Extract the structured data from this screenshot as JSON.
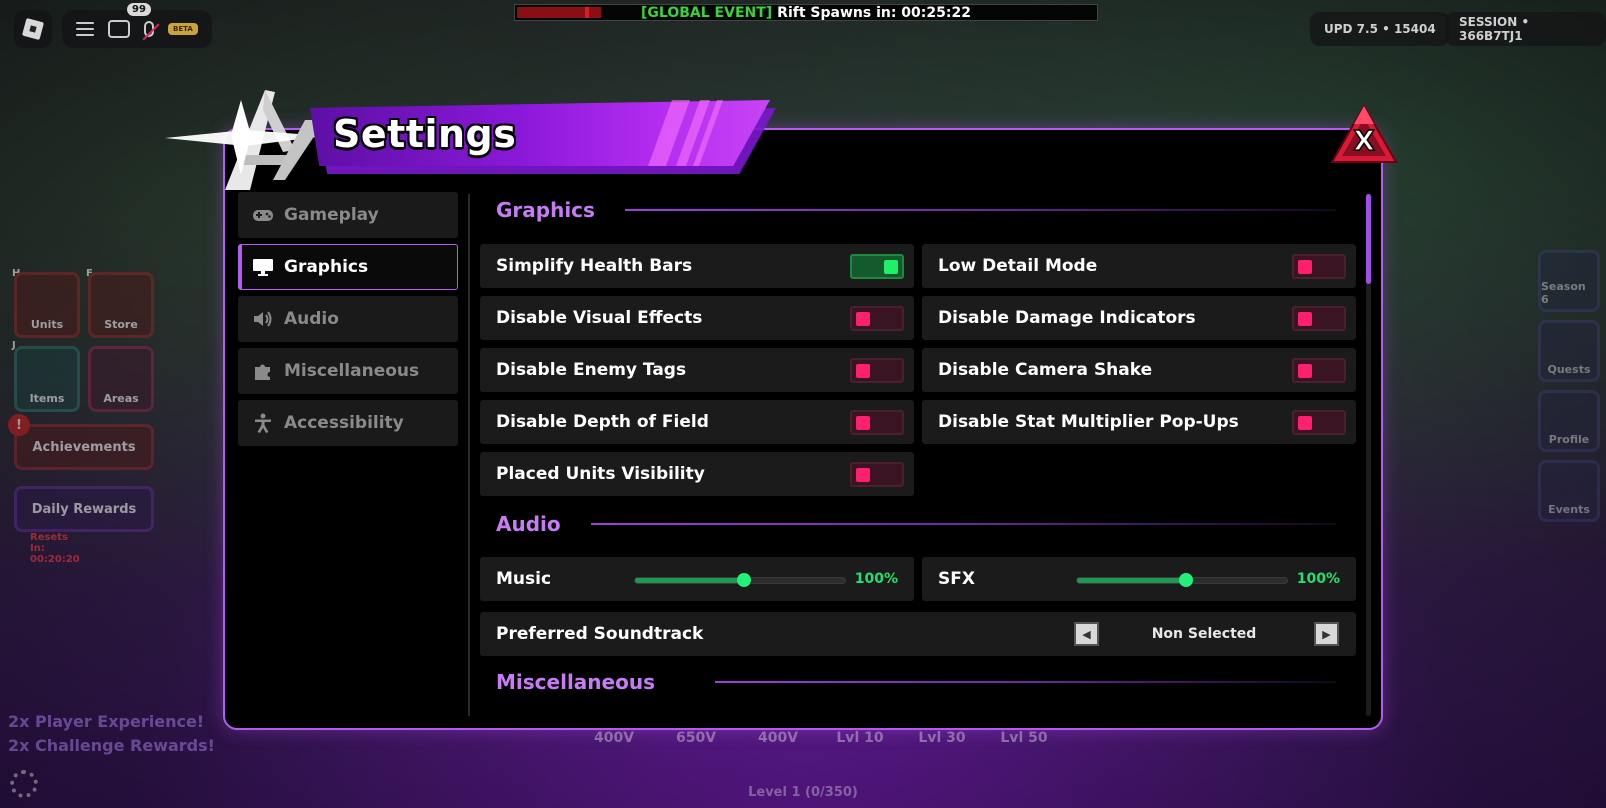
{
  "topbar": {
    "chat_badge": "99",
    "beta_label": "BETA",
    "event_tag": "[GLOBAL EVENT]",
    "event_text": "Rift Spawns in: 00:25:22",
    "version": "UPD 7.5 • 15404",
    "session": "SESSION • 366B7TJ1"
  },
  "hud_left": {
    "units": {
      "key": "H",
      "label": "Units"
    },
    "store": {
      "key": "F",
      "label": "Store"
    },
    "items": {
      "key": "J",
      "label": "Items"
    },
    "areas": {
      "label": "Areas"
    },
    "achievements": "Achievements",
    "alert": "!",
    "daily_rewards": "Daily Rewards",
    "daily_reset": "Resets In: 00:20:20"
  },
  "hud_right": {
    "season": "Season 6",
    "quests": "Quests",
    "profile": "Profile",
    "events": "Events"
  },
  "hud_bottom": {
    "slots": [
      "400V",
      "650V",
      "400V",
      "Lvl 10",
      "Lvl 30",
      "Lvl 50"
    ],
    "level": "Level 1 (0/350)",
    "bonus1": "2x Player Experience!",
    "bonus2": "2x Challenge Rewards!"
  },
  "settings": {
    "title": "Settings",
    "close_label": "X",
    "tabs": [
      {
        "label": "Gameplay",
        "icon": "gamepad-icon",
        "active": false
      },
      {
        "label": "Graphics",
        "icon": "monitor-icon",
        "active": true
      },
      {
        "label": "Audio",
        "icon": "speaker-icon",
        "active": false
      },
      {
        "label": "Miscellaneous",
        "icon": "puzzle-icon",
        "active": false
      },
      {
        "label": "Accessibility",
        "icon": "person-icon",
        "active": false
      }
    ],
    "sections": {
      "graphics": "Graphics",
      "audio": "Audio",
      "misc": "Miscellaneous"
    },
    "graphics_left": [
      {
        "label": "Simplify Health Bars",
        "on": true
      },
      {
        "label": "Disable Visual Effects",
        "on": false
      },
      {
        "label": "Disable Enemy Tags",
        "on": false
      },
      {
        "label": "Disable Depth of Field",
        "on": false
      },
      {
        "label": "Placed Units Visibility",
        "on": false
      }
    ],
    "graphics_right": [
      {
        "label": "Low Detail Mode",
        "on": false
      },
      {
        "label": "Disable Damage Indicators",
        "on": false
      },
      {
        "label": "Disable Camera Shake",
        "on": false
      },
      {
        "label": "Disable Stat Multiplier Pop-Ups",
        "on": false
      }
    ],
    "audio": {
      "music": {
        "label": "Music",
        "value": "100%",
        "level": 0.52
      },
      "sfx": {
        "label": "SFX",
        "value": "100%",
        "level": 0.52
      },
      "soundtrack": {
        "label": "Preferred Soundtrack",
        "value": "Non Selected"
      }
    },
    "colors": {
      "accent": "#b45cf2",
      "toggle_on": "#1ef068",
      "toggle_off": "#ff1f6e",
      "section_title": "#c77bf5"
    }
  }
}
